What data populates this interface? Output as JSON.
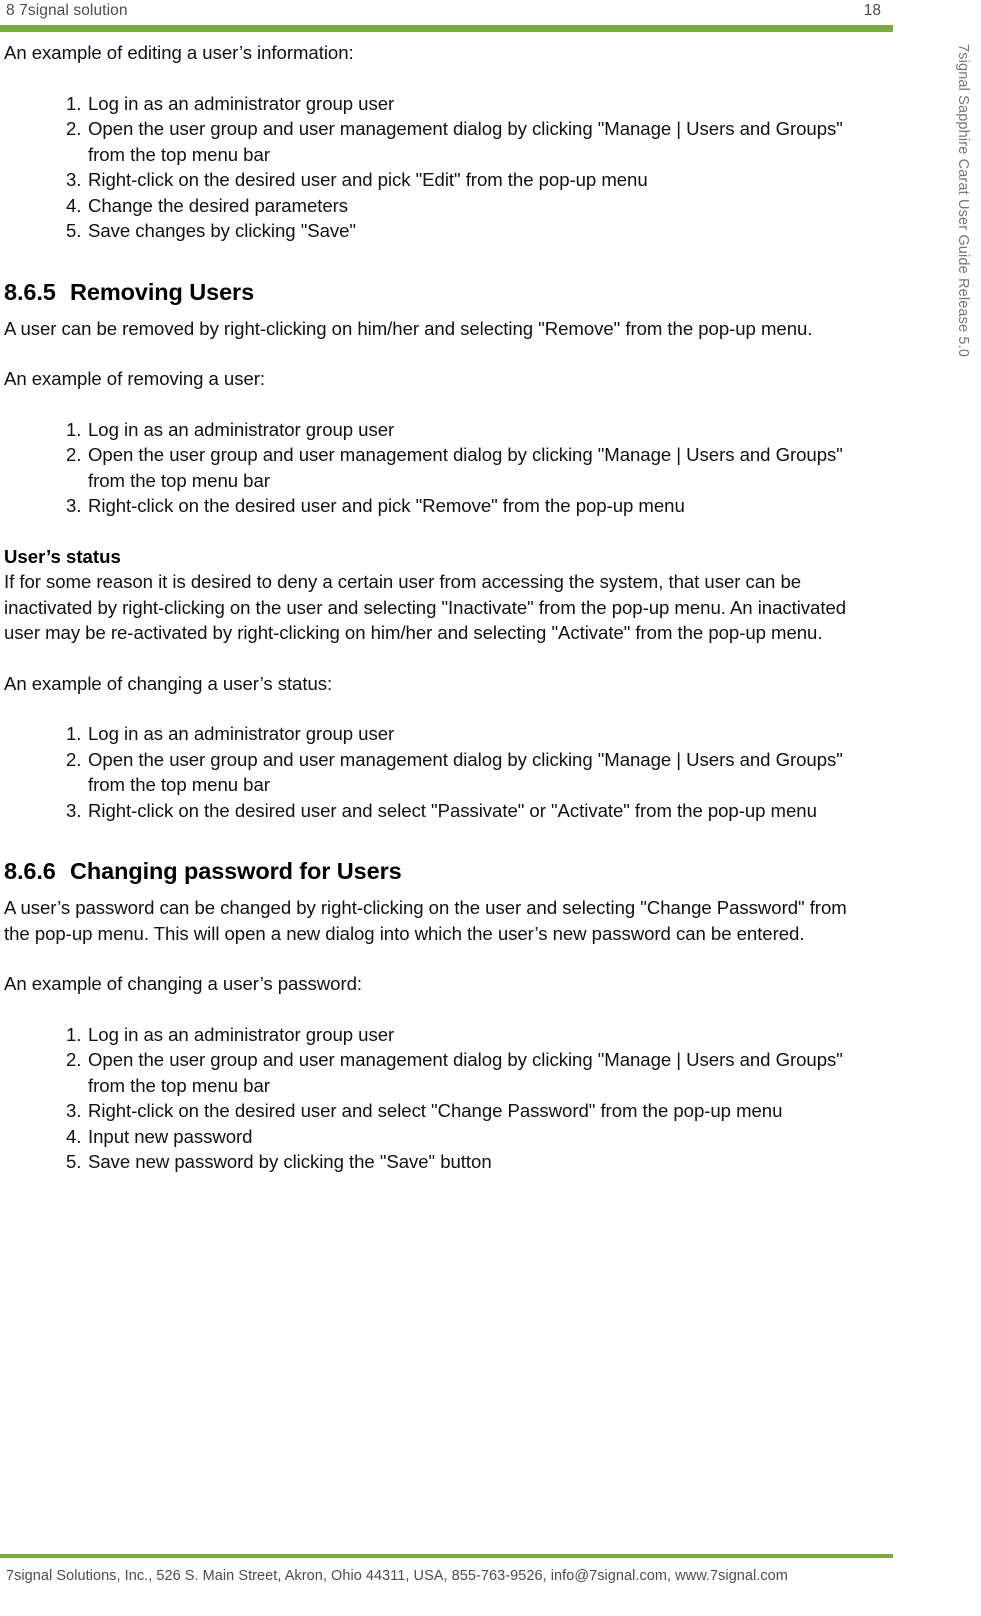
{
  "header": {
    "title": "8 7signal solution",
    "page_number": "18"
  },
  "side_title": "7signal Sapphire Carat User Guide Release 5.0",
  "accent_color": "#76ad3c",
  "content": {
    "intro_editing": "An example of editing a user’s information:",
    "editing_steps": [
      "Log in as an administrator group user",
      "Open the user group and user management dialog by clicking \"Manage | Users and Groups\" from the top menu bar",
      "Right-click on the desired user and pick \"Edit\" from the pop-up menu",
      "Change the desired parameters",
      "Save changes by clicking \"Save\""
    ],
    "section_865": {
      "number": "8.6.5",
      "title": "Removing Users",
      "body": "A user can be removed by right-clicking on him/her and selecting \"Remove\" from the pop-up menu.",
      "intro": "An example of removing a user:",
      "steps": [
        "Log in as an administrator group user",
        "Open the user group and user management dialog by clicking \"Manage | Users and Groups\" from the top menu bar",
        "Right-click on the desired user and pick \"Remove\" from the pop-up menu"
      ]
    },
    "user_status": {
      "subheading": "User’s status",
      "body": "If for some reason it is desired to deny a certain user from accessing the system, that user can be inactivated by right-clicking on the user and selecting \"Inactivate\" from the pop-up menu. An inactivated user may be re-activated by right-clicking on him/her and selecting \"Activate\" from the pop-up menu.",
      "intro": "An example of changing a user’s status:",
      "steps": [
        "Log in as an administrator group user",
        "Open the user group and user management dialog by clicking \"Manage | Users and Groups\" from the top menu bar",
        "Right-click on the desired user and select \"Passivate\" or \"Activate\" from the pop-up menu"
      ]
    },
    "section_866": {
      "number": "8.6.6",
      "title": "Changing password for Users",
      "body": "A user’s password can be changed by right-clicking on the user and selecting \"Change Password\" from the pop-up menu. This will open a new dialog into which the user’s new password can be entered.",
      "intro": "An example of changing a user’s password:",
      "steps": [
        "Log in as an administrator group user",
        "Open the user group and user management dialog by clicking \"Manage | Users and Groups\" from the top menu bar",
        "Right-click on the desired user and select \"Change Password\" from the pop-up menu",
        "Input new password",
        "Save new password by clicking the \"Save\" button"
      ]
    }
  },
  "footer": {
    "text": "7signal Solutions, Inc., 526 S. Main Street, Akron, Ohio 44311, USA, 855-763-9526, info@7signal.com, www.7signal.com"
  }
}
